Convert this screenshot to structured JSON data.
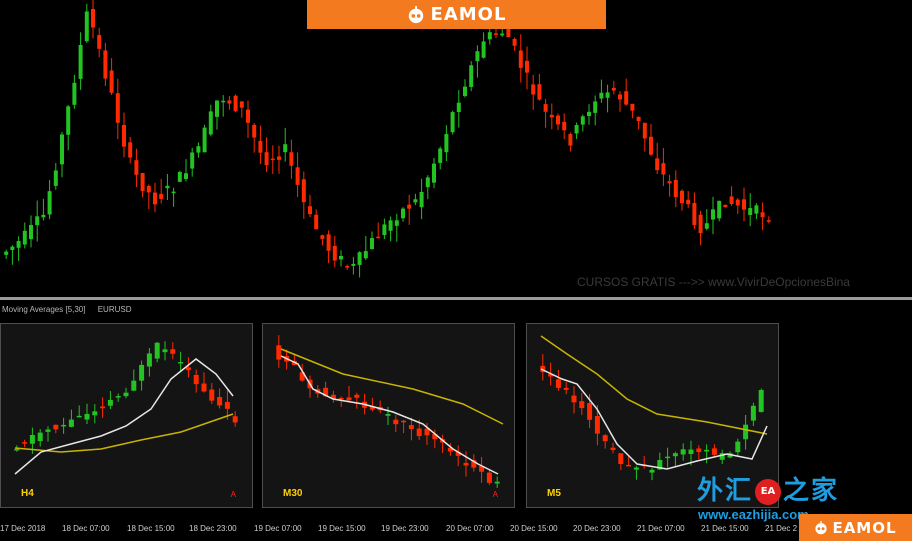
{
  "brand": {
    "top_label": "EAMOL",
    "bottom_label": "EAMOL",
    "color": "#f47a20"
  },
  "watermark": "CURSOS GRATIS --->> www.VivirDeOpcionesBina",
  "indicator": {
    "name": "Moving Averages [5,30]",
    "symbol": "EURUSD"
  },
  "colors": {
    "bull": "#22c322",
    "bear": "#ff2a00",
    "fast_ma": "#e6e6e6",
    "slow_ma": "#c8b400",
    "timeframe_label": "#ffd200"
  },
  "panels": [
    {
      "timeframe": "H4",
      "marker": "A"
    },
    {
      "timeframe": "M30",
      "marker": "A"
    },
    {
      "timeframe": "M5",
      "marker": ""
    }
  ],
  "time_axis": [
    "17 Dec 2018",
    "18 Dec 07:00",
    "18 Dec 15:00",
    "18 Dec 23:00",
    "19 Dec 07:00",
    "19 Dec 15:00",
    "19 Dec 23:00",
    "20 Dec 07:00",
    "20 Dec 15:00",
    "20 Dec 23:00",
    "21 Dec 07:00",
    "21 Dec 15:00",
    "21 Dec 2"
  ],
  "site": {
    "name_left": "外汇",
    "badge": "EA",
    "name_right": "之家",
    "url": "www.eazhijia.com"
  }
}
